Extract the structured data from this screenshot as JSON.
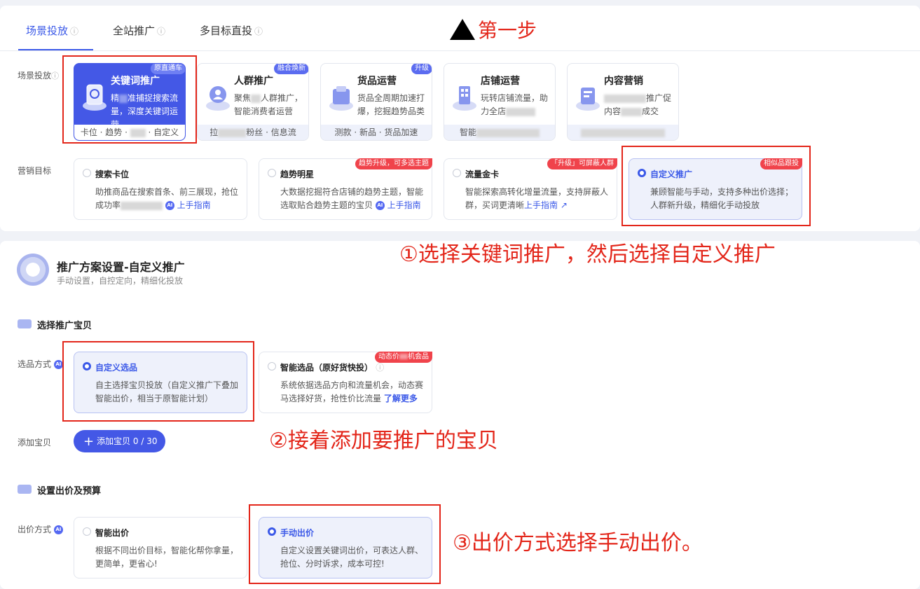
{
  "tabs": [
    {
      "label": "场景投放",
      "help": "?"
    },
    {
      "label": "全站推广",
      "help": "?"
    },
    {
      "label": "多目标直投",
      "help": "?"
    }
  ],
  "step_title": "第一步",
  "scene": {
    "label": "场景投放",
    "cards": [
      {
        "title": "关键词推广",
        "desc": "精准捕捉搜索流量，深度关键词运营",
        "foot": "卡位 · 趋势 · ___ · 自定义",
        "badge": "原直通车"
      },
      {
        "title": "人群推广",
        "desc": "聚焦___人群推广，智能消费者运营",
        "foot": "拉新 · 会员 · 粉丝 · 信息流",
        "badge": "融合焕新"
      },
      {
        "title": "货品运营",
        "desc": "货品全周期加速打爆，挖掘趋势品类",
        "foot": "测款 · 新品 · 货品加速",
        "badge": "升级"
      },
      {
        "title": "店铺运营",
        "desc": "玩转店铺流量，助力全店___",
        "foot": "智能___",
        "badge": ""
      },
      {
        "title": "内容营销",
        "desc": "___推广促内容___成交",
        "foot": "___",
        "badge": ""
      }
    ]
  },
  "goal": {
    "label": "营销目标",
    "cards": [
      {
        "title": "搜索卡位",
        "desc": "助推商品在搜索首条、前三展现，抢位成功率",
        "link": "上手指南",
        "badge": ""
      },
      {
        "title": "趋势明星",
        "desc": "大数据挖掘符合店铺的趋势主题，智能选取贴合趋势主题的宝贝",
        "link": "上手指南",
        "badge": "趋势升级，可多选主题"
      },
      {
        "title": "流量金卡",
        "desc": "智能探索高转化增量流量，支持屏蔽人群，买词更清晰",
        "link": "上手指南",
        "badge": "「升级」可屏蔽人群"
      },
      {
        "title": "自定义推广",
        "desc": "兼顾智能与手动，支持多种出价选择；人群新升级，精细化手动投放",
        "link": "",
        "badge": "相似品跟投"
      }
    ]
  },
  "annotations": {
    "a1": "①选择关键词推广，然后选择自定义推广",
    "a2": "②接着添加要推广的宝贝",
    "a3": "③出价方式选择手动出价。"
  },
  "plan": {
    "title": "推广方案设置-自定义推广",
    "subtitle": "手动设置，自控定向，精细化投放"
  },
  "select_item": {
    "section_title": "选择推广宝贝",
    "label": "选品方式",
    "cards": [
      {
        "title": "自定义选品",
        "desc": "自主选择宝贝投放（自定义推广下叠加智能出价，相当于原智能计划）",
        "badge": ""
      },
      {
        "title": "智能选品（原好货快投）",
        "desc": "系统依据选品方向和流量机会，动态赛马选择好货，抢性价比流量",
        "link": "了解更多",
        "badge": "动态价格机会品"
      }
    ],
    "add_label": "添加宝贝",
    "add_button": "添加宝贝 0 / 30"
  },
  "bid": {
    "section_title": "设置出价及预算",
    "label": "出价方式",
    "cards": [
      {
        "title": "智能出价",
        "desc": "根据不同出价目标，智能化帮你拿量，更简单，更省心!"
      },
      {
        "title": "手动出价",
        "desc": "自定义设置关键词出价，可表达人群、抢位、分时诉求，成本可控!"
      }
    ]
  },
  "colors": {
    "accent": "#3b59e8",
    "annotation_red": "#e3261a",
    "badge_red": "#f0434b"
  }
}
